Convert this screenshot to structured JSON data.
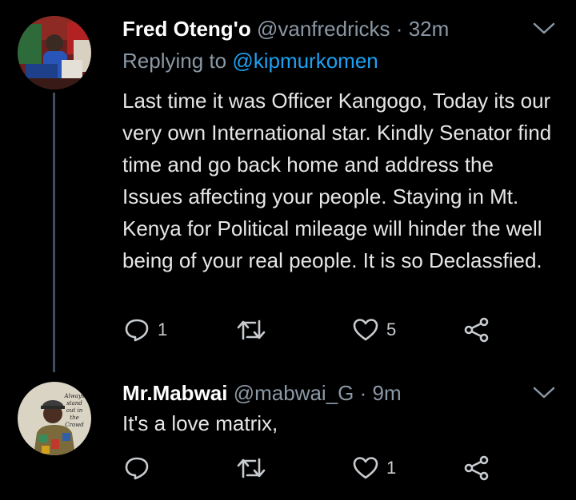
{
  "colors": {
    "background": "#000000",
    "name": "#ffffff",
    "secondary": "#8b98a5",
    "mention": "#1da1f2",
    "thread_line": "#3d4e5e",
    "icon": "#c8ccd0"
  },
  "tweets": [
    {
      "name": "Fred Oteng'o",
      "handle": "@vanfredricks",
      "separator": "·",
      "time": "32m",
      "reply_prefix": "Replying to",
      "reply_mention": "@kipmurkomen",
      "text": "Last time it was Officer Kangogo, Today its our very own International star. Kindly Senator find time and go back home and address the Issues affecting your people. Staying in Mt. Kenya for Political mileage will hinder the well being of your real people. It is so Declassfied.",
      "reply_count": "1",
      "retweet_count": "",
      "like_count": "5",
      "icons": [
        "reply-icon",
        "retweet-icon",
        "heart-icon",
        "share-icon",
        "chevron-down-icon"
      ]
    },
    {
      "name": "Mr.Mabwai",
      "handle": "@mabwai_G",
      "separator": "·",
      "time": "9m",
      "text": "It's a love matrix,",
      "reply_count": "",
      "retweet_count": "",
      "like_count": "1",
      "avatar_text": "Always stand out in the Crowd",
      "icons": [
        "reply-icon",
        "retweet-icon",
        "heart-icon",
        "share-icon",
        "chevron-down-icon"
      ]
    }
  ]
}
